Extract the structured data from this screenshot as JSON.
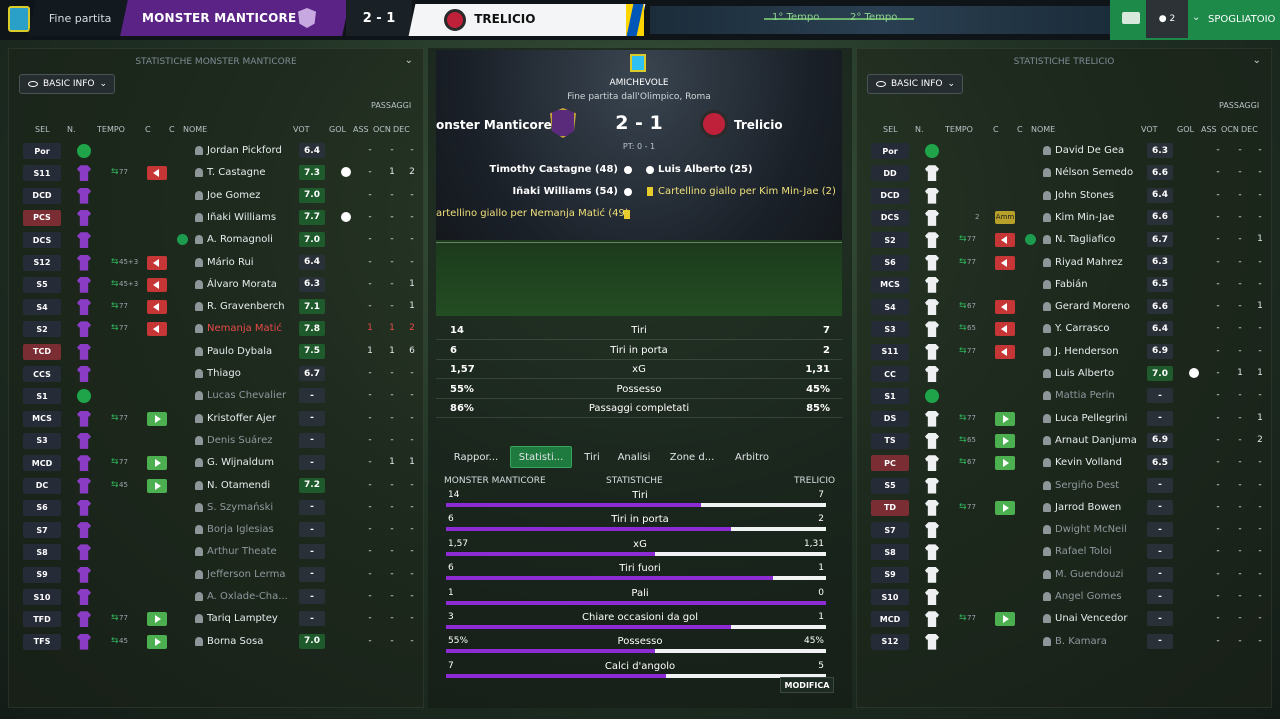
{
  "topbar": {
    "status": "Fine partita",
    "home_name": "MONSTER MANTICORE",
    "score": "2 - 1",
    "away_name": "TRELICIO",
    "t1": "1° Tempo",
    "t2": "2° Tempo",
    "count": "2",
    "dressing": "SPOGLIATOIO"
  },
  "left": {
    "title": "STATISTICHE MONSTER MANTICORE",
    "basic": "BASIC INFO",
    "h": {
      "sel": "SEL",
      "n": "N.",
      "tempo": "TEMPO",
      "c1": "C",
      "c2": "C",
      "nome": "NOME",
      "vot": "VOT",
      "gol": "GOL",
      "ass": "ASS",
      "passaggi": "PASSAGGI",
      "ocn": "OCN",
      "dec": "DEC"
    },
    "rows": [
      {
        "pos": "Por",
        "n": "1",
        "name": "Jordan Pickford",
        "vot": "6.4",
        "ass": "-",
        "ocn": "-",
        "dec": "-",
        "gk": true
      },
      {
        "pos": "S11",
        "n": "2",
        "name": "T. Castagne",
        "vot": "7.3",
        "ass": "-",
        "ocn": "1",
        "dec": "2",
        "off": "77",
        "goal": true
      },
      {
        "pos": "DCD",
        "n": "4",
        "name": "Joe Gomez",
        "vot": "7.0",
        "ass": "-",
        "ocn": "-",
        "dec": "-"
      },
      {
        "pos": "PCS",
        "n": "6",
        "name": "Iñaki Williams",
        "vot": "7.7",
        "ass": "-",
        "ocn": "-",
        "dec": "-",
        "goal": true,
        "red": true
      },
      {
        "pos": "DCS",
        "n": "5",
        "name": "A. Romagnoli",
        "vot": "7.0",
        "ass": "-",
        "ocn": "-",
        "dec": "-",
        "cap": true
      },
      {
        "pos": "S12",
        "n": "3",
        "name": "Mário Rui",
        "vot": "6.4",
        "ass": "-",
        "ocn": "-",
        "dec": "-",
        "off": "45+3"
      },
      {
        "pos": "S5",
        "n": "9",
        "name": "Álvaro Morata",
        "vot": "6.3",
        "ass": "-",
        "ocn": "-",
        "dec": "1",
        "off": "45+3"
      },
      {
        "pos": "S4",
        "n": "8",
        "name": "R. Gravenberch",
        "vot": "7.1",
        "ass": "-",
        "ocn": "-",
        "dec": "1",
        "off": "77"
      },
      {
        "pos": "S2",
        "n": "7",
        "name": "Nemanja Matić",
        "vot": "7.8",
        "ass": "1",
        "ocn": "1",
        "dec": "2",
        "off": "77",
        "redname": true
      },
      {
        "pos": "TCD",
        "n": "10",
        "name": "Paulo Dybala",
        "vot": "7.5",
        "ass": "1",
        "ocn": "1",
        "dec": "6",
        "red": true
      },
      {
        "pos": "CCS",
        "n": "11",
        "name": "Thiago",
        "vot": "6.7",
        "ass": "-",
        "ocn": "-",
        "dec": "-"
      },
      {
        "pos": "S1",
        "n": "12",
        "name": "Lucas Chevalier",
        "vot": "-",
        "ass": "-",
        "ocn": "-",
        "dec": "-",
        "gk": true,
        "dim": true
      },
      {
        "pos": "MCS",
        "n": "13",
        "name": "Kristoffer Ajer",
        "vot": "-",
        "ass": "-",
        "ocn": "-",
        "dec": "-",
        "on": "77"
      },
      {
        "pos": "S3",
        "n": "14",
        "name": "Denis Suárez",
        "vot": "-",
        "ass": "-",
        "ocn": "-",
        "dec": "-",
        "dim": true
      },
      {
        "pos": "MCD",
        "n": "15",
        "name": "G. Wijnaldum",
        "vot": "-",
        "ass": "-",
        "ocn": "1",
        "dec": "1",
        "on": "77"
      },
      {
        "pos": "DC",
        "n": "16",
        "name": "N. Otamendi",
        "vot": "7.2",
        "ass": "-",
        "ocn": "-",
        "dec": "-",
        "on": "45"
      },
      {
        "pos": "S6",
        "n": "17",
        "name": "S. Szymański",
        "vot": "-",
        "ass": "-",
        "ocn": "-",
        "dec": "-",
        "dim": true
      },
      {
        "pos": "S7",
        "n": "18",
        "name": "Borja Iglesias",
        "vot": "-",
        "ass": "-",
        "ocn": "-",
        "dec": "-",
        "dim": true
      },
      {
        "pos": "S8",
        "n": "19",
        "name": "Arthur Theate",
        "vot": "-",
        "ass": "-",
        "ocn": "-",
        "dec": "-",
        "dim": true
      },
      {
        "pos": "S9",
        "n": "20",
        "name": "Jefferson Lerma",
        "vot": "-",
        "ass": "-",
        "ocn": "-",
        "dec": "-",
        "dim": true
      },
      {
        "pos": "S10",
        "n": "21",
        "name": "A. Oxlade-Cha...",
        "vot": "-",
        "ass": "-",
        "ocn": "-",
        "dec": "-",
        "dim": true
      },
      {
        "pos": "TFD",
        "n": "22",
        "name": "Tariq Lamptey",
        "vot": "-",
        "ass": "-",
        "ocn": "-",
        "dec": "-",
        "on": "77"
      },
      {
        "pos": "TFS",
        "n": "23",
        "name": "Borna Sosa",
        "vot": "7.0",
        "ass": "-",
        "ocn": "-",
        "dec": "-",
        "on": "45"
      }
    ]
  },
  "right": {
    "title": "STATISTICHE TRELICIO",
    "basic": "BASIC INFO",
    "h": {
      "sel": "SEL",
      "n": "N.",
      "tempo": "TEMPO",
      "c1": "C",
      "c2": "C",
      "nome": "NOME",
      "vot": "VOT",
      "gol": "GOL",
      "ass": "ASS",
      "passaggi": "PASSAGGI",
      "ocn": "OCN",
      "dec": "DEC"
    },
    "rows": [
      {
        "pos": "Por",
        "n": "1",
        "name": "David De Gea",
        "vot": "6.3",
        "ass": "-",
        "ocn": "-",
        "dec": "-",
        "gk": true
      },
      {
        "pos": "DD",
        "n": "2",
        "name": "Nélson Semedo",
        "vot": "6.6",
        "ass": "-",
        "ocn": "-",
        "dec": "-"
      },
      {
        "pos": "DCD",
        "n": "4",
        "name": "John Stones",
        "vot": "6.4",
        "ass": "-",
        "ocn": "-",
        "dec": "-"
      },
      {
        "pos": "DCS",
        "n": "5",
        "name": "Kim Min-Jae",
        "vot": "6.6",
        "ass": "-",
        "ocn": "-",
        "dec": "-",
        "yel": "2",
        "amm": "Amm"
      },
      {
        "pos": "S2",
        "n": "3",
        "name": "N. Tagliafico",
        "vot": "6.7",
        "ass": "-",
        "ocn": "-",
        "dec": "1",
        "off": "77",
        "cap": true
      },
      {
        "pos": "S6",
        "n": "11",
        "name": "Riyad Mahrez",
        "vot": "6.3",
        "ass": "-",
        "ocn": "-",
        "dec": "-",
        "off": "77"
      },
      {
        "pos": "MCS",
        "n": "6",
        "name": "Fabián",
        "vot": "6.5",
        "ass": "-",
        "ocn": "-",
        "dec": "-"
      },
      {
        "pos": "S4",
        "n": "8",
        "name": "Gerard Moreno",
        "vot": "6.6",
        "ass": "-",
        "ocn": "-",
        "dec": "1",
        "off": "67"
      },
      {
        "pos": "S3",
        "n": "9",
        "name": "Y. Carrasco",
        "vot": "6.4",
        "ass": "-",
        "ocn": "-",
        "dec": "-",
        "off": "65"
      },
      {
        "pos": "S11",
        "n": "10",
        "name": "J. Henderson",
        "vot": "6.9",
        "ass": "-",
        "ocn": "-",
        "dec": "-",
        "off": "77"
      },
      {
        "pos": "CC",
        "n": "7",
        "name": "Luis Alberto",
        "vot": "7.0",
        "ass": "-",
        "ocn": "1",
        "dec": "1",
        "goal": true
      },
      {
        "pos": "S1",
        "n": "12",
        "name": "Mattia Perin",
        "vot": "-",
        "ass": "-",
        "ocn": "-",
        "dec": "-",
        "gk": true,
        "dim": true
      },
      {
        "pos": "DS",
        "n": "13",
        "name": "Luca Pellegrini",
        "vot": "-",
        "ass": "-",
        "ocn": "-",
        "dec": "1",
        "on": "77"
      },
      {
        "pos": "TS",
        "n": "14",
        "name": "Arnaut Danjuma",
        "vot": "6.9",
        "ass": "-",
        "ocn": "-",
        "dec": "2",
        "on": "65"
      },
      {
        "pos": "PC",
        "n": "15",
        "name": "Kevin Volland",
        "vot": "6.5",
        "ass": "-",
        "ocn": "-",
        "dec": "-",
        "on": "67",
        "red": true
      },
      {
        "pos": "S5",
        "n": "16",
        "name": "Sergiño Dest",
        "vot": "-",
        "ass": "-",
        "ocn": "-",
        "dec": "-",
        "dim": true
      },
      {
        "pos": "TD",
        "n": "17",
        "name": "Jarrod Bowen",
        "vot": "-",
        "ass": "-",
        "ocn": "-",
        "dec": "-",
        "on": "77",
        "red": true
      },
      {
        "pos": "S7",
        "n": "18",
        "name": "Dwight McNeil",
        "vot": "-",
        "ass": "-",
        "ocn": "-",
        "dec": "-",
        "dim": true
      },
      {
        "pos": "S8",
        "n": "19",
        "name": "Rafael Toloi",
        "vot": "-",
        "ass": "-",
        "ocn": "-",
        "dec": "-",
        "dim": true
      },
      {
        "pos": "S9",
        "n": "20",
        "name": "M. Guendouzi",
        "vot": "-",
        "ass": "-",
        "ocn": "-",
        "dec": "-",
        "dim": true
      },
      {
        "pos": "S10",
        "n": "21",
        "name": "Angel Gomes",
        "vot": "-",
        "ass": "-",
        "ocn": "-",
        "dec": "-",
        "dim": true
      },
      {
        "pos": "MCD",
        "n": "22",
        "name": "Unai Vencedor",
        "vot": "-",
        "ass": "-",
        "ocn": "-",
        "dec": "-",
        "on": "77"
      },
      {
        "pos": "S12",
        "n": "23",
        "name": "B. Kamara",
        "vot": "-",
        "ass": "-",
        "ocn": "-",
        "dec": "-",
        "dim": true
      }
    ]
  },
  "center": {
    "competition": "AMICHEVOLE",
    "venue": "Fine partita dall'Olimpico, Roma",
    "home": "onster Manticore",
    "score": "2 - 1",
    "away": "Trelicio",
    "ht": "PT: 0 - 1",
    "events": {
      "h1": "Timothy Castagne (48)",
      "h2": "Iñaki Williams (54)",
      "h3": "artellino giallo per Nemanja Matić (49)",
      "a1": "Luis Alberto (25)",
      "a2": "Cartellino giallo per Kim Min-Jae (2)"
    },
    "summary": [
      {
        "l": "14",
        "m": "Tiri",
        "r": "7"
      },
      {
        "l": "6",
        "m": "Tiri in porta",
        "r": "2"
      },
      {
        "l": "1,57",
        "m": "xG",
        "r": "1,31"
      },
      {
        "l": "55%",
        "m": "Possesso",
        "r": "45%"
      },
      {
        "l": "86%",
        "m": "Passaggi completati",
        "r": "85%"
      }
    ],
    "tabs": [
      "Rappor...",
      "Statisti...",
      "Tiri",
      "Analisi",
      "Zone d...",
      "Arbitro"
    ],
    "cmp": {
      "home": "MONSTER MANTICORE",
      "mid": "STATISTICHE",
      "away": "TRELICIO"
    },
    "rows": [
      {
        "l": "14",
        "m": "Tiri",
        "r": "7",
        "pct": 0.67
      },
      {
        "l": "6",
        "m": "Tiri in porta",
        "r": "2",
        "pct": 0.75
      },
      {
        "l": "1,57",
        "m": "xG",
        "r": "1,31",
        "pct": 0.55
      },
      {
        "l": "6",
        "m": "Tiri fuori",
        "r": "1",
        "pct": 0.86
      },
      {
        "l": "1",
        "m": "Pali",
        "r": "0",
        "pct": 1.0
      },
      {
        "l": "3",
        "m": "Chiare occasioni da gol",
        "r": "1",
        "pct": 0.75
      },
      {
        "l": "55%",
        "m": "Possesso",
        "r": "45%",
        "pct": 0.55
      },
      {
        "l": "7",
        "m": "Calci d'angolo",
        "r": "5",
        "pct": 0.58
      }
    ],
    "modifica": "MODIFICA"
  }
}
